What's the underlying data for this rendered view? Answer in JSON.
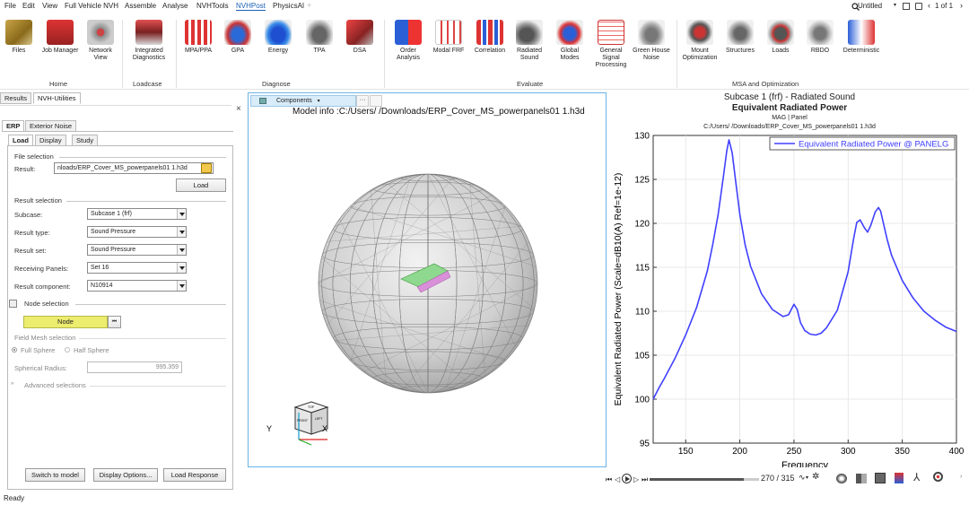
{
  "menu": {
    "items": [
      "File",
      "Edit",
      "View",
      "Full Vehicle NVH",
      "Assemble",
      "Analyse",
      "NVHTools",
      "NVHPost",
      "PhysicsAI"
    ],
    "active": "NVHPost",
    "plus": "+"
  },
  "topright": {
    "document": "Untitled",
    "pages": "1 of 1"
  },
  "ribbon": {
    "home": {
      "label": "Home",
      "buttons": [
        "Files",
        "Job Manager",
        "Network View"
      ]
    },
    "loadcase": {
      "label": "Loadcase",
      "buttons": [
        "Integrated Diagnostics"
      ]
    },
    "diagnose": {
      "label": "Diagnose",
      "buttons": [
        "MPA/PPA",
        "GPA",
        "Energy",
        "TPA",
        "DSA"
      ]
    },
    "evaluate": {
      "label": "Evaluate",
      "buttons": [
        "Order Analysis",
        "Modal FRF",
        "Correlation",
        "Radiated Sound",
        "Global Modes",
        "General Signal Processing",
        "Green House Noise"
      ]
    },
    "msa": {
      "label": "MSA and Optimization",
      "buttons": [
        "Mount Optimization",
        "Structures",
        "Loads",
        "RBDO",
        "Deterministic"
      ]
    }
  },
  "left_panel": {
    "tabs": [
      "Results",
      "NVH-Utilities"
    ],
    "close": "×",
    "subtabs": [
      "ERP",
      "Exterior Noise"
    ],
    "innertabs": [
      "Load",
      "Display",
      "Study"
    ],
    "file_selection": {
      "title": "File selection",
      "result_label": "Result:",
      "result_value": "nloads/ERP_Cover_MS_powerpanels01 1.h3d",
      "load_button": "Load"
    },
    "result_selection": {
      "title": "Result selection",
      "fields": [
        {
          "label": "Subcase:",
          "value": "Subcase 1 (frf)"
        },
        {
          "label": "Result type:",
          "value": "Sound Pressure"
        },
        {
          "label": "Result set:",
          "value": "Sound Pressure"
        },
        {
          "label": "Receiving Panels:",
          "value": "Set 16"
        },
        {
          "label": "Result component:",
          "value": "N10914"
        }
      ]
    },
    "node_selection": {
      "title": "Node selection",
      "node_button": "Node"
    },
    "field_mesh": {
      "title": "Field Mesh selection",
      "option_full": "Full Sphere",
      "option_half": "Half Sphere",
      "radius_label": "Spherical Radius:",
      "radius_value": "995.359"
    },
    "advanced": "Advanced selections",
    "buttons": [
      "Switch to model",
      "Display Options...",
      "Load Response"
    ]
  },
  "viewport": {
    "components_button": "Components",
    "more": "···",
    "model_info": "Model info :C:/Users/     /Downloads/ERP_Cover_MS_powerpanels01 1.h3d",
    "axis_y": "Y",
    "axis_x": "X",
    "cube_labels": [
      "FRONT",
      "LEFT",
      "TOP"
    ]
  },
  "chart_data": {
    "type": "line",
    "title": "Subcase 1 (frf) - Radiated Sound",
    "subtitle": "Equivalent Radiated Power",
    "meta_line": "MAG | Panel",
    "file_line": "C:/Users/     /Downloads/ERP_Cover_MS_powerpanels01 1.h3d",
    "xlabel": "Frequency",
    "ylabel": "Equivalent Radiated Power (Scale=dB10(A) Ref=1e-12)",
    "xlim": [
      120,
      400
    ],
    "ylim": [
      95,
      130
    ],
    "xticks": [
      150,
      200,
      250,
      300,
      350,
      400
    ],
    "yticks": [
      95,
      100,
      105,
      110,
      115,
      120,
      125,
      130
    ],
    "grid": true,
    "legend_position": "top-right",
    "series": [
      {
        "name": "Equivalent Radiated Power @ PANELG",
        "color": "#4040ff",
        "x": [
          120,
          125,
          130,
          140,
          150,
          160,
          170,
          175,
          180,
          185,
          188,
          190,
          193,
          197,
          200,
          205,
          210,
          220,
          230,
          240,
          245,
          250,
          253,
          256,
          260,
          265,
          270,
          275,
          280,
          290,
          300,
          305,
          308,
          311,
          315,
          318,
          321,
          325,
          328,
          330,
          333,
          336,
          340,
          350,
          360,
          370,
          380,
          390,
          400
        ],
        "y": [
          100.0,
          101.2,
          102.3,
          104.6,
          107.3,
          110.4,
          114.6,
          117.6,
          121.0,
          125.5,
          128.3,
          129.5,
          128.0,
          124.0,
          121.0,
          117.5,
          115.1,
          112.0,
          110.2,
          109.4,
          109.6,
          110.8,
          110.2,
          108.7,
          107.8,
          107.4,
          107.3,
          107.5,
          108.1,
          110.1,
          114.5,
          118.2,
          120.1,
          120.4,
          119.5,
          119.0,
          119.8,
          121.3,
          121.8,
          121.4,
          119.8,
          118.2,
          116.4,
          113.5,
          111.5,
          110.0,
          109.0,
          108.2,
          107.7
        ]
      }
    ]
  },
  "anim": {
    "frame": "270 / 315"
  },
  "status": {
    "text": "Ready"
  }
}
